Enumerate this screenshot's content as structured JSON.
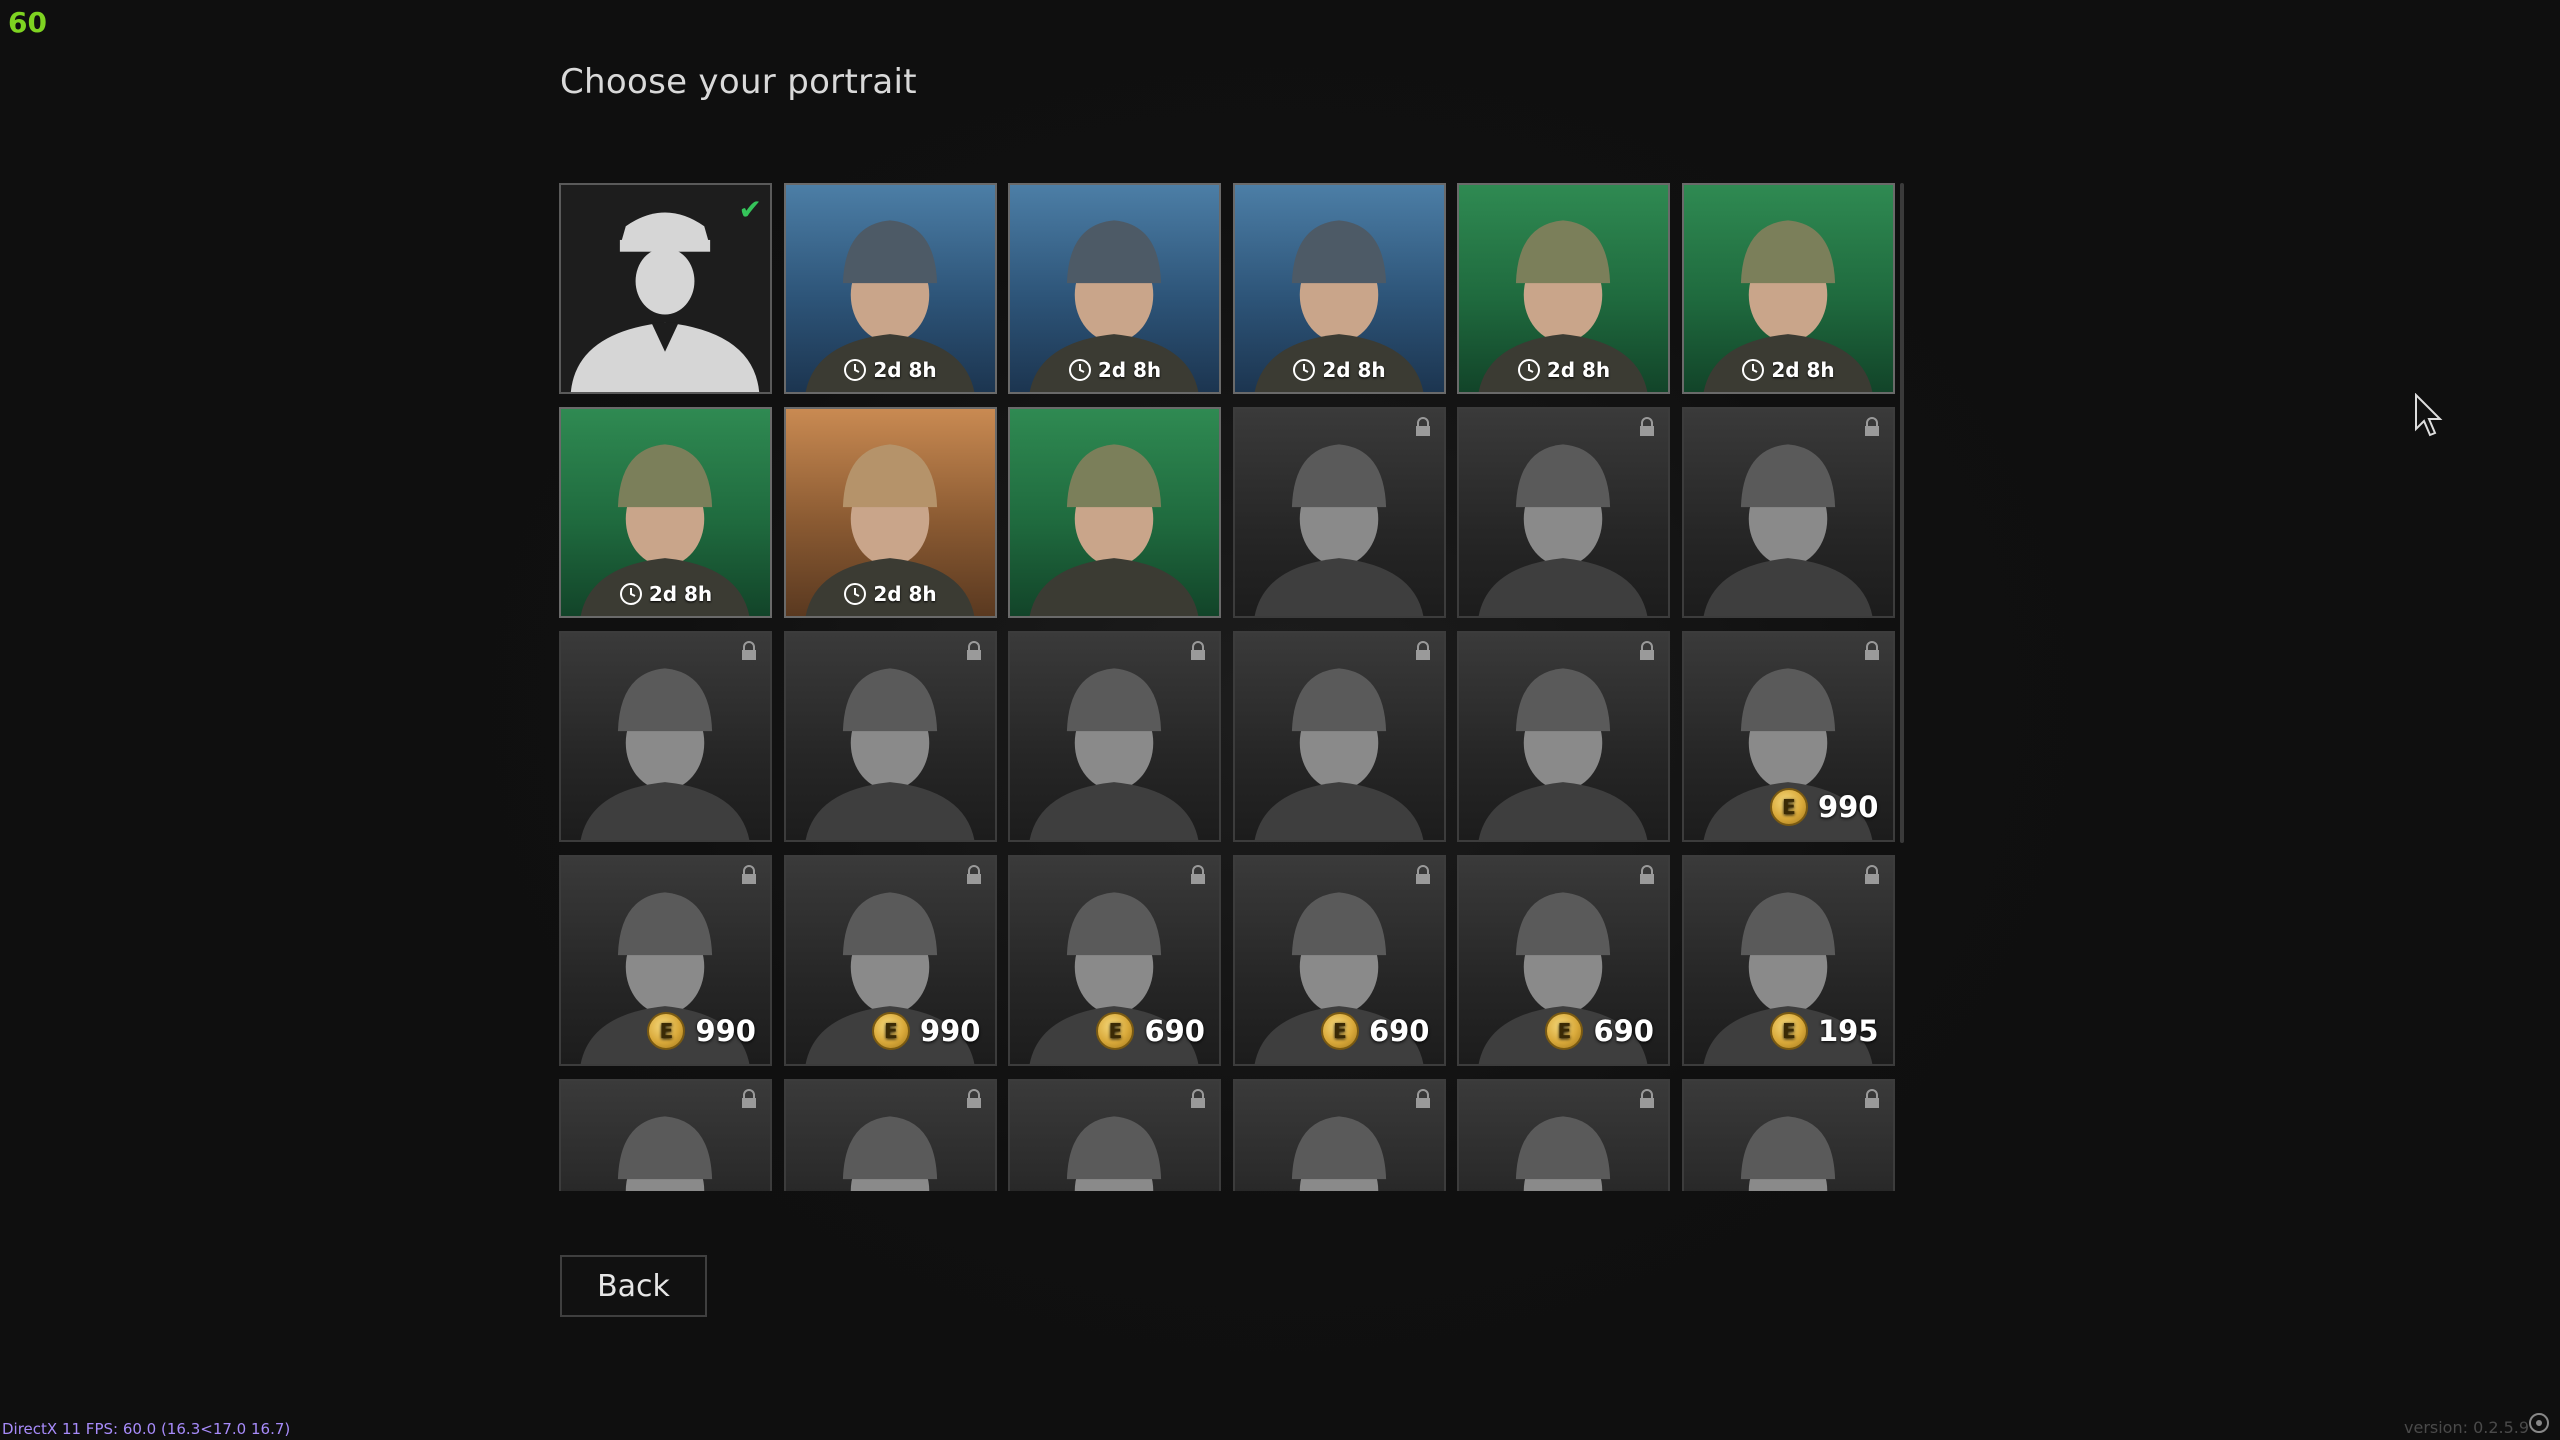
{
  "hud": {
    "fps": "60",
    "perf": "DirectX 11 FPS: 60.0 (16.3<17.0 16.7)",
    "version": "version: 0.2.5.9"
  },
  "title": "Choose your portrait",
  "back_label": "Back",
  "colors": {
    "accent_green": "#35c45a",
    "fps_green": "#7ed321",
    "coin_gold": "#d9a93a"
  },
  "portraits": [
    {
      "theme": "default",
      "state": "selected",
      "icon": "officer-silhouette-icon"
    },
    {
      "theme": "blue",
      "state": "timed",
      "timer": "2d 8h"
    },
    {
      "theme": "blue",
      "state": "timed",
      "timer": "2d 8h"
    },
    {
      "theme": "blue",
      "state": "timed",
      "timer": "2d 8h"
    },
    {
      "theme": "green",
      "state": "timed",
      "timer": "2d 8h"
    },
    {
      "theme": "green",
      "state": "timed",
      "timer": "2d 8h"
    },
    {
      "theme": "green",
      "state": "timed",
      "timer": "2d 8h"
    },
    {
      "theme": "amber",
      "state": "timed",
      "timer": "2d 8h"
    },
    {
      "theme": "green",
      "state": "owned"
    },
    {
      "theme": "gray",
      "state": "locked"
    },
    {
      "theme": "gray",
      "state": "locked"
    },
    {
      "theme": "gray",
      "state": "locked"
    },
    {
      "theme": "gray",
      "state": "locked"
    },
    {
      "theme": "gray",
      "state": "locked"
    },
    {
      "theme": "gray",
      "state": "locked"
    },
    {
      "theme": "gray",
      "state": "locked"
    },
    {
      "theme": "gray",
      "state": "locked"
    },
    {
      "theme": "gray",
      "state": "locked",
      "price": "990"
    },
    {
      "theme": "gray",
      "state": "locked",
      "price": "990"
    },
    {
      "theme": "gray",
      "state": "locked",
      "price": "990"
    },
    {
      "theme": "gray",
      "state": "locked",
      "price": "690"
    },
    {
      "theme": "gray",
      "state": "locked",
      "price": "690"
    },
    {
      "theme": "gray",
      "state": "locked",
      "price": "690"
    },
    {
      "theme": "gray",
      "state": "locked",
      "price": "195"
    },
    {
      "theme": "gray",
      "state": "locked"
    },
    {
      "theme": "gray",
      "state": "locked"
    },
    {
      "theme": "gray",
      "state": "locked"
    },
    {
      "theme": "gray",
      "state": "locked"
    },
    {
      "theme": "gray",
      "state": "locked"
    },
    {
      "theme": "gray",
      "state": "locked"
    }
  ]
}
